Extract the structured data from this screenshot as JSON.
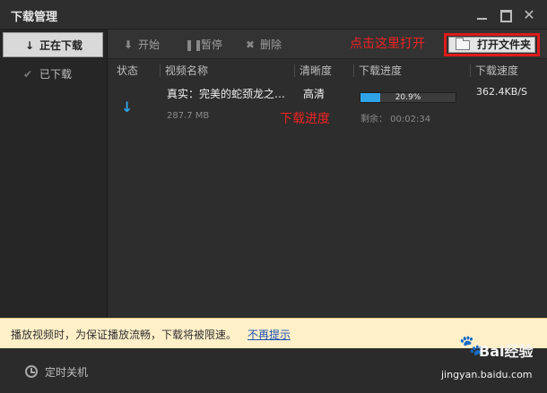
{
  "window": {
    "title": "下载管理",
    "min_icon": "minimize-icon",
    "max_icon": "maximize-icon",
    "close_label": "✕"
  },
  "sidebar": {
    "items": [
      {
        "label": "正在下载",
        "icon": "↓",
        "active": true
      },
      {
        "label": "已下载",
        "icon": "✔",
        "active": false
      }
    ]
  },
  "toolbar": {
    "start_label": "开始",
    "start_icon": "⬇",
    "pause_label": "暂停",
    "pause_icon": "❚❚",
    "delete_label": "删除",
    "delete_icon": "✖",
    "open_folder_label": "打开文件夹"
  },
  "annotations": {
    "open_hint": "点击这里打开",
    "progress_hint": "下载进度"
  },
  "table": {
    "headers": [
      "状态",
      "视频名称",
      "清晰度",
      "下载进度",
      "下载速度"
    ],
    "rows": [
      {
        "state_icon": "↓",
        "name": "真实：完美的蛇颈龙之…",
        "size": "287.7 MB",
        "clarity": "高清",
        "progress": 0.209,
        "progress_text": "20.9%",
        "remaining": "剩余： 00:02:34",
        "speed": "362.4KB/S"
      }
    ]
  },
  "notice": {
    "text": "播放视频时，为保证播放流畅，下载将被限速。",
    "link": "不再提示"
  },
  "footer": {
    "timer_label": "定时关机"
  },
  "watermark": {
    "icon": "🐾",
    "brand": "Bai经验",
    "url": "jingyan.baidu.com"
  },
  "colors": {
    "accent": "#2ea3e8",
    "annotation": "#e22222",
    "notice_bg": "#fff0c8"
  }
}
